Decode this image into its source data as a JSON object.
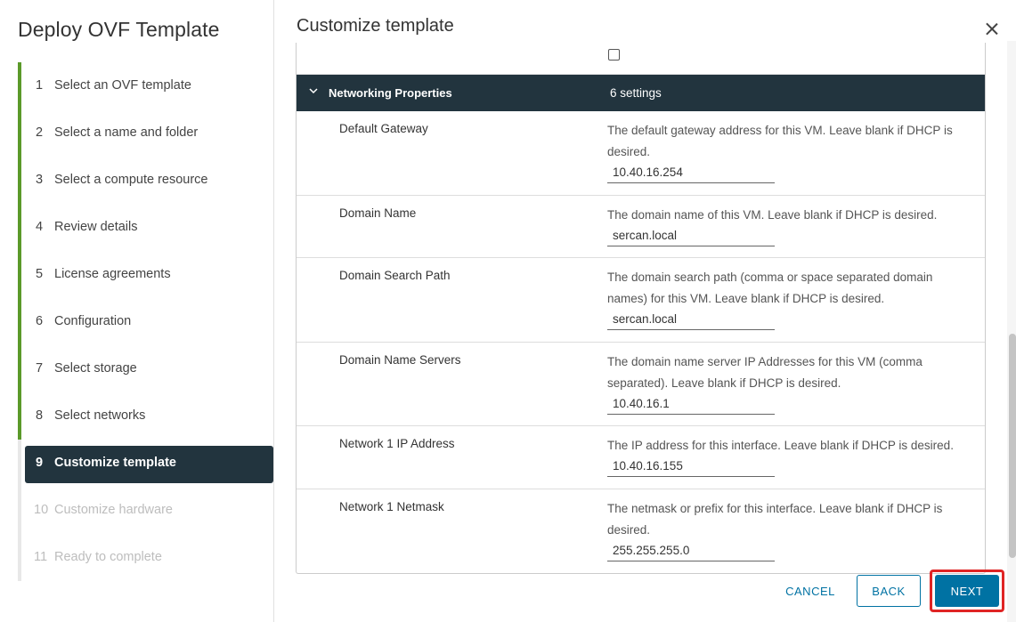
{
  "sidebar": {
    "title": "Deploy OVF Template",
    "steps": [
      {
        "num": "1",
        "label": "Select an OVF template"
      },
      {
        "num": "2",
        "label": "Select a name and folder"
      },
      {
        "num": "3",
        "label": "Select a compute resource"
      },
      {
        "num": "4",
        "label": "Review details"
      },
      {
        "num": "5",
        "label": "License agreements"
      },
      {
        "num": "6",
        "label": "Configuration"
      },
      {
        "num": "7",
        "label": "Select storage"
      },
      {
        "num": "8",
        "label": "Select networks"
      },
      {
        "num": "9",
        "label": "Customize template"
      },
      {
        "num": "10",
        "label": "Customize hardware"
      },
      {
        "num": "11",
        "label": "Ready to complete"
      }
    ]
  },
  "main": {
    "title": "Customize template",
    "section": {
      "label": "Networking Properties",
      "count": "6 settings"
    },
    "properties": [
      {
        "name": "Default Gateway",
        "description": "The default gateway address for this VM. Leave blank if DHCP is desired.",
        "value": "10.40.16.254"
      },
      {
        "name": "Domain Name",
        "description": "The domain name of this VM. Leave blank if DHCP is desired.",
        "value": "sercan.local"
      },
      {
        "name": "Domain Search Path",
        "description": "The domain search path (comma or space separated domain names) for this VM. Leave blank if DHCP is desired.",
        "value": "sercan.local"
      },
      {
        "name": "Domain Name Servers",
        "description": "The domain name server IP Addresses for this VM (comma separated). Leave blank if DHCP is desired.",
        "value": "10.40.16.1"
      },
      {
        "name": "Network 1 IP Address",
        "description": "The IP address for this interface. Leave blank if DHCP is desired.",
        "value": "10.40.16.155"
      },
      {
        "name": "Network 1 Netmask",
        "description": "The netmask or prefix for this interface. Leave blank if DHCP is desired.",
        "value": "255.255.255.0"
      }
    ]
  },
  "footer": {
    "cancel_label": "CANCEL",
    "back_label": "BACK",
    "next_label": "NEXT"
  },
  "colors": {
    "accent": "#0072a3",
    "active_step_bg": "#22343e",
    "completed_bar": "#5b9a2a",
    "highlight": "#e02424"
  },
  "icons": {
    "close": "close-icon",
    "section_toggle": "chevron-down-icon"
  }
}
